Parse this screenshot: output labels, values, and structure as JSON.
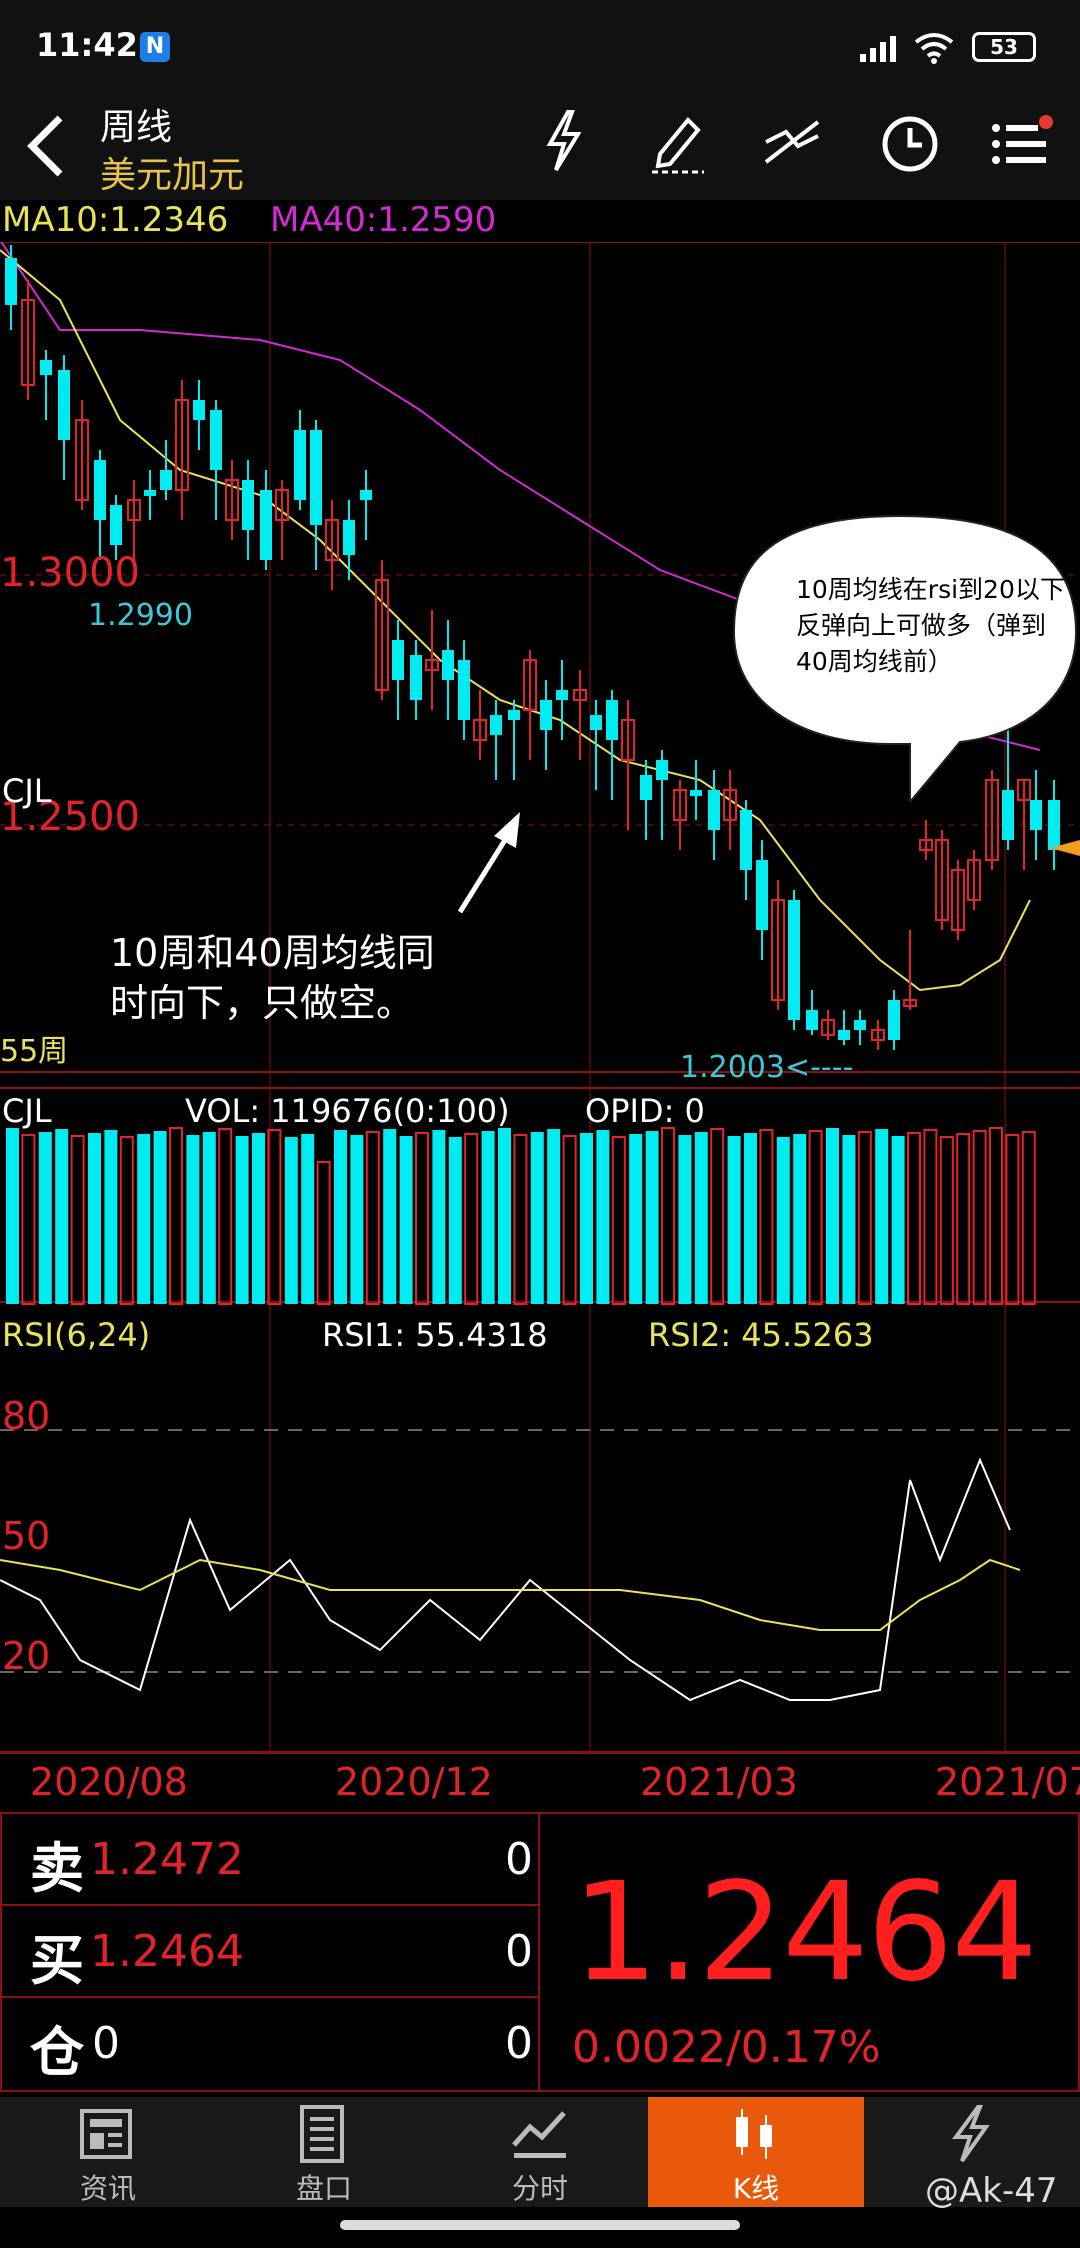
{
  "status": {
    "time": "11:42",
    "app_badge": "N",
    "battery": "53"
  },
  "header": {
    "period": "周线",
    "instrument": "美元加元"
  },
  "ma": {
    "ma10": "MA10:1.2346",
    "ma40": "MA40:1.2590"
  },
  "price_labels": {
    "p1": "1.3000",
    "p2": "1.2500",
    "low_mark": "1.2990",
    "min_mark": "1.2003<----",
    "period_label": "55周"
  },
  "annotations": {
    "bubble": "10周均线在rsi到20以下反弹向上可做多（弹到40周均线前）",
    "note_line1": "10周和40周均线同",
    "note_line2": "时向下，只做空。"
  },
  "volume": {
    "title": "CJL",
    "vol": "VOL: 119676(0:100)",
    "opid": "OPID: 0"
  },
  "rsi": {
    "title": "RSI(6,24)",
    "rsi1": "RSI1: 55.4318",
    "rsi2": "RSI2: 45.5263",
    "l80": "80",
    "l50": "50",
    "l20": "20"
  },
  "dates": [
    "2020/08",
    "2020/12",
    "2021/03",
    "2021/07"
  ],
  "quote": {
    "sell_label": "卖",
    "sell_price": "1.2472",
    "sell_qty": "0",
    "buy_label": "买",
    "buy_price": "1.2464",
    "buy_qty": "0",
    "pos_label": "仓",
    "pos_value": "0",
    "pos_qty": "0",
    "last": "1.2464",
    "change": "0.0022/0.17%"
  },
  "tabs": [
    "资讯",
    "盘口",
    "分时",
    "K线",
    ""
  ],
  "watermark": "@Ak-47",
  "colors": {
    "up": "#e0242a",
    "down": "#00ecf0",
    "ma10": "#e9e35a",
    "ma40": "#d42ad4",
    "grid": "#8b1010",
    "active_tab": "#e8590c"
  }
}
